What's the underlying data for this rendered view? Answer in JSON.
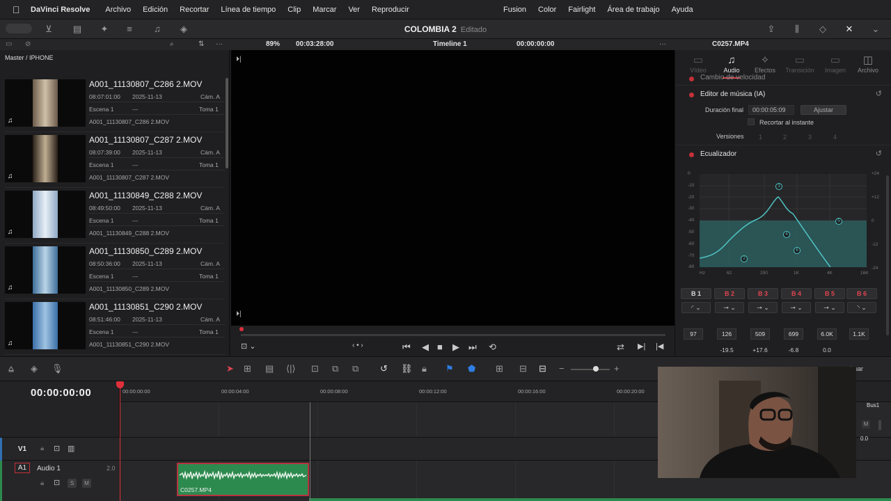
{
  "menubar": {
    "app_name": "DaVinci Resolve",
    "items": [
      "Archivo",
      "Edición",
      "Recortar",
      "Línea de tiempo",
      "Clip",
      "Marcar",
      "Ver",
      "Reproducir"
    ],
    "right_items": [
      "Fusion",
      "Color",
      "Fairlight",
      "Área de trabajo",
      "Ayuda"
    ]
  },
  "toolbar": {
    "project_name": "COLOMBIA 2",
    "project_status": "Editado"
  },
  "subbar": {
    "zoom": "89%",
    "duration": "00:03:28:00",
    "timeline_name": "Timeline 1",
    "timecode": "00:00:00:00",
    "inspector_clip": "C0257.MP4"
  },
  "pool": {
    "breadcrumb": "Master / IPHONE",
    "clips": [
      {
        "name": "A001_11130807_C286 2.MOV",
        "time": "08:07:01:00",
        "date": "2025-11-13",
        "cam": "Cám. A",
        "scene": "Escena 1",
        "dash": "---",
        "take": "Toma 1",
        "file": "A001_11130807_C286 2.MOV"
      },
      {
        "name": "A001_11130807_C287 2.MOV",
        "time": "08:07:39:00",
        "date": "2025-11-13",
        "cam": "Cám. A",
        "scene": "Escena 1",
        "dash": "---",
        "take": "Toma 1",
        "file": "A001_11130807_C287 2.MOV"
      },
      {
        "name": "A001_11130849_C288 2.MOV",
        "time": "08:49:50:00",
        "date": "2025-11-13",
        "cam": "Cám. A",
        "scene": "Escena 1",
        "dash": "---",
        "take": "Toma 1",
        "file": "A001_11130849_C288 2.MOV"
      },
      {
        "name": "A001_11130850_C289 2.MOV",
        "time": "08:50:36:00",
        "date": "2025-11-13",
        "cam": "Cám. A",
        "scene": "Escena 1",
        "dash": "---",
        "take": "Toma 1",
        "file": "A001_11130850_C289 2.MOV"
      },
      {
        "name": "A001_11130851_C290 2.MOV",
        "time": "08:51:46:00",
        "date": "2025-11-13",
        "cam": "Cám. A",
        "scene": "Escena 1",
        "dash": "---",
        "take": "Toma 1",
        "file": "A001_11130851_C290 2.MOV"
      }
    ]
  },
  "inspector": {
    "tabs": [
      "Vídeo",
      "Audio",
      "Efectos",
      "Transición",
      "Imagen",
      "Archivo"
    ],
    "active_tab": "Audio",
    "speed_section": "Cambio de velocidad",
    "music_section": "Editor de música (IA)",
    "final_duration_label": "Duración final",
    "final_duration_value": "00:00:05:09",
    "adjust_button": "Ajustar",
    "trim_label": "Recortar al instante",
    "versions_label": "Versiones",
    "versions": [
      "1",
      "2",
      "3",
      "4"
    ],
    "eq_section": "Ecualizador",
    "eq_db_left": [
      "0",
      "-10",
      "-20",
      "-30",
      "-40",
      "-50",
      "-60",
      "-70",
      "-80"
    ],
    "eq_db_right": [
      "+24",
      "+12",
      "0",
      "-12",
      "-24"
    ],
    "eq_freq": [
      "Hz",
      "62",
      "250",
      "1K",
      "4K",
      "16K"
    ],
    "eq_nodes": [
      "2",
      "3",
      "4",
      "5",
      "6"
    ],
    "bands": [
      {
        "label": "B 1",
        "shape": "◜",
        "freq": "97",
        "gain": "",
        "color": "#d8d8d8"
      },
      {
        "label": "B 2",
        "shape": "⊸",
        "freq": "126",
        "gain": "-19.5",
        "color": "#e0444f"
      },
      {
        "label": "B 3",
        "shape": "⊸",
        "freq": "509",
        "gain": "+17.6",
        "color": "#e0444f"
      },
      {
        "label": "B 4",
        "shape": "⊸",
        "freq": "699",
        "gain": "-6.8",
        "color": "#e0444f"
      },
      {
        "label": "B 5",
        "shape": "⊸",
        "freq": "6.0K",
        "gain": "0.0",
        "color": "#e0444f"
      },
      {
        "label": "B 6",
        "shape": "◝",
        "freq": "1.1K",
        "gain": "",
        "color": "#e0444f"
      }
    ],
    "eq_color": "#4fc4c4"
  },
  "timeline": {
    "timecode": "00:00:00:00",
    "ruler": [
      "00:00:00:00",
      "00:00:04:00",
      "00:00:08:00",
      "00:00:12:00",
      "00:00:16:00",
      "00:00:20:00"
    ],
    "v1": "V1",
    "a1": "A1",
    "audio_track": "Audio 1",
    "audio_level": "2.0",
    "clip_name": "C0257.MP4",
    "bus_label": "Bus1",
    "meter_value": "0.0",
    "sm_s": "S",
    "sm_m": "M",
    "overlay_text": "huar"
  }
}
